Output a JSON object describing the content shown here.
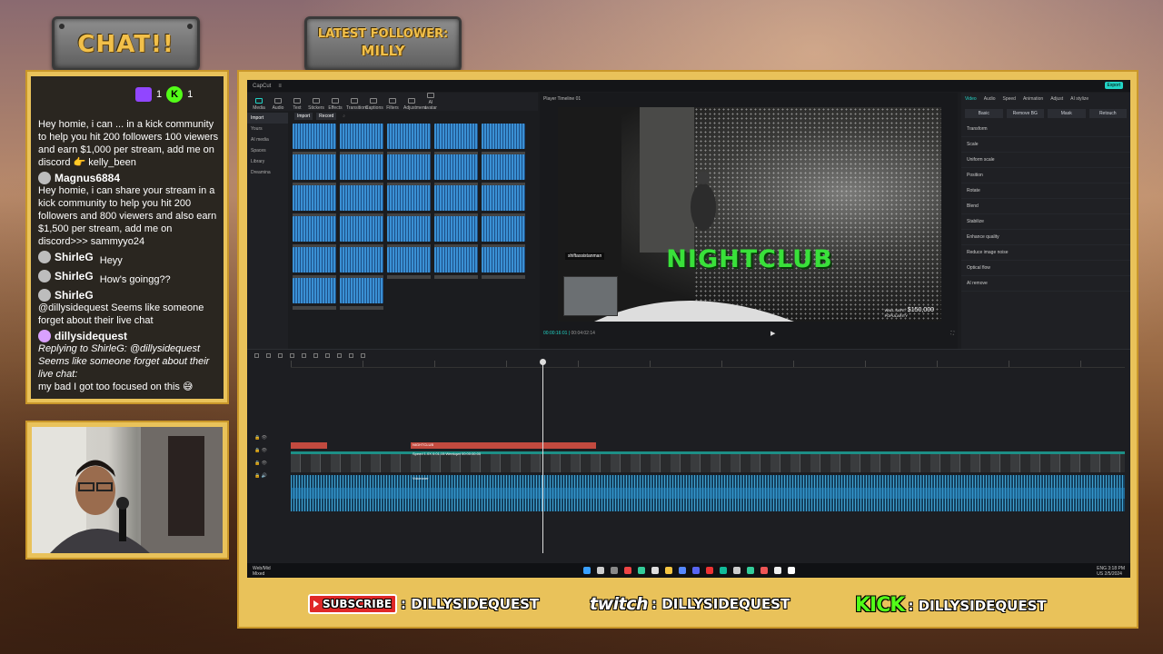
{
  "overlay": {
    "chat_title": "CHAT!!",
    "latest_follower_label": "LATEST FOLLOWER:",
    "latest_follower_name": "MILLY",
    "chat_badges": {
      "twitch_count": "1",
      "kick_count": "1"
    }
  },
  "chat": {
    "messages": [
      {
        "text": "Hey homie, i can ... in a kick community to help you hit 200 followers 100 viewers and earn $1,000 per stream, add me on discord 👉 kelly_been"
      },
      {
        "user": "Magnus6884",
        "text": "Hey homie, i can share your stream in a kick community to help you hit 200 followers and 800 viewers and also earn $1,500 per stream, add me on discord>>> sammyyo24"
      },
      {
        "user": "ShirleG",
        "text": "Heyy"
      },
      {
        "user": "ShirleG",
        "text": "How's goingg??"
      },
      {
        "user": "ShirleG",
        "text": "@dillysidequest Seems like someone forget about their live chat"
      },
      {
        "user": "dillysidequest",
        "text": "Replying to ShirleG: @dillysidequest Seems like someone forget about their live chat:",
        "reply": "my bad I got too focused on this 😅"
      }
    ]
  },
  "editor": {
    "app_name": "CapCut",
    "tools": [
      "Media",
      "Audio",
      "Text",
      "Stickers",
      "Effects",
      "Transitions",
      "Captions",
      "Filters",
      "Adjustment",
      "AI avatar"
    ],
    "media_sidebar": [
      "Import",
      "Yours",
      "AI media",
      "Spaces",
      "Library",
      "Dreamina"
    ],
    "media_tabs": {
      "import": "Import",
      "record": "Record"
    },
    "player_label": "Player Timeline 01",
    "player_time": "00:00:16:01",
    "player_duration": "00:04:02:14",
    "overlay_text": "NIGHTCLUB",
    "hud_name": "shiftassistanman",
    "hud_money_label": "WALL SAFE:",
    "hud_money": "$150,000",
    "hud_popularity": "POPULARITY",
    "props_tabs": [
      "Video",
      "Audio",
      "Speed",
      "Animation",
      "Adjust",
      "AI stylize"
    ],
    "props_sub": [
      "Basic",
      "Remove BG",
      "Mask",
      "Retouch"
    ],
    "props_rows": [
      "Transform",
      "Scale",
      "Uniform scale",
      "Position",
      "Rotate",
      "Blend",
      "Stabilize",
      "Enhance quality",
      "Reduce image noise",
      "Optical flow",
      "AI remove"
    ],
    "export_label": "Export",
    "timeline": {
      "text_clip_1": "",
      "text_clip_2": "NIGHTCLUB",
      "video_clip_label": "Speed 1.0X  0:01:15:Weekqwt  00:00:00:00",
      "audio_clip_label": "Voiceover"
    },
    "taskbar": {
      "left_top": "Web/Mid",
      "left_bottom": "Mixed",
      "lang_top": "ENG",
      "lang_bottom": "US",
      "time": "3:18 PM",
      "date": "2/5/2024"
    }
  },
  "social": {
    "youtube_label": "SUBSCRIBE",
    "youtube_handle": ": DILLYSIDEQUEST",
    "twitch_word": "twitch",
    "twitch_handle": ": DILLYSIDEQUEST",
    "kick_word": "KICK",
    "kick_handle": ": DILLYSIDEQUEST"
  },
  "colors": {
    "gold": "#e9c25a",
    "accent": "#22d3c5",
    "nightclub_green": "#39e13a",
    "kick_green": "#53fc18",
    "twitch_purple": "#9146ff",
    "youtube_red": "#e02828"
  }
}
